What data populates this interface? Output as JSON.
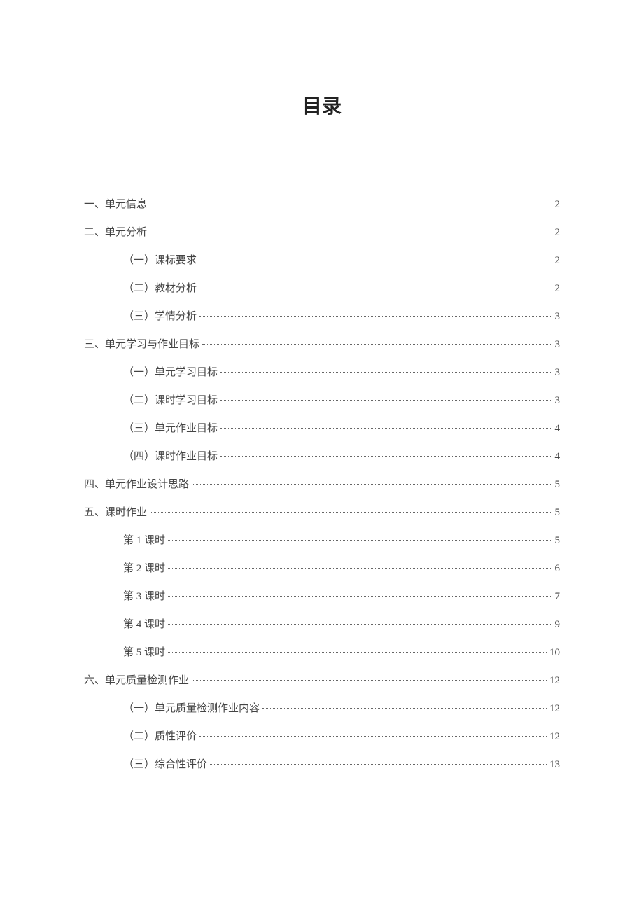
{
  "title": "目录",
  "toc": [
    {
      "level": 1,
      "label": "一、单元信息",
      "page": "2"
    },
    {
      "level": 1,
      "label": "二、单元分析",
      "page": "2"
    },
    {
      "level": 2,
      "label": "（一）课标要求",
      "page": "2"
    },
    {
      "level": 2,
      "label": "（二）教材分析",
      "page": "2"
    },
    {
      "level": 2,
      "label": "（三）学情分析",
      "page": "3"
    },
    {
      "level": 1,
      "label": "三、单元学习与作业目标",
      "page": "3"
    },
    {
      "level": 2,
      "label": "（一）单元学习目标",
      "page": "3"
    },
    {
      "level": 2,
      "label": "（二）课时学习目标",
      "page": "3"
    },
    {
      "level": 2,
      "label": "（三）单元作业目标",
      "page": "4"
    },
    {
      "level": 2,
      "label": "（四）课时作业目标",
      "page": "4"
    },
    {
      "level": 1,
      "label": "四、单元作业设计思路",
      "page": "5"
    },
    {
      "level": 1,
      "label": "五、课时作业",
      "page": "5"
    },
    {
      "level": 2,
      "label": "第 1 课时",
      "page": "5"
    },
    {
      "level": 2,
      "label": "第 2 课时",
      "page": "6"
    },
    {
      "level": 2,
      "label": "第 3 课时",
      "page": "7"
    },
    {
      "level": 2,
      "label": "第 4 课时",
      "page": "9"
    },
    {
      "level": 2,
      "label": "第 5 课时",
      "page": "10"
    },
    {
      "level": 1,
      "label": "六、单元质量检测作业",
      "page": "12"
    },
    {
      "level": 2,
      "label": "（一）单元质量检测作业内容",
      "page": "12"
    },
    {
      "level": 2,
      "label": "（二）质性评价",
      "page": "12"
    },
    {
      "level": 2,
      "label": "（三）综合性评价",
      "page": "13"
    }
  ]
}
